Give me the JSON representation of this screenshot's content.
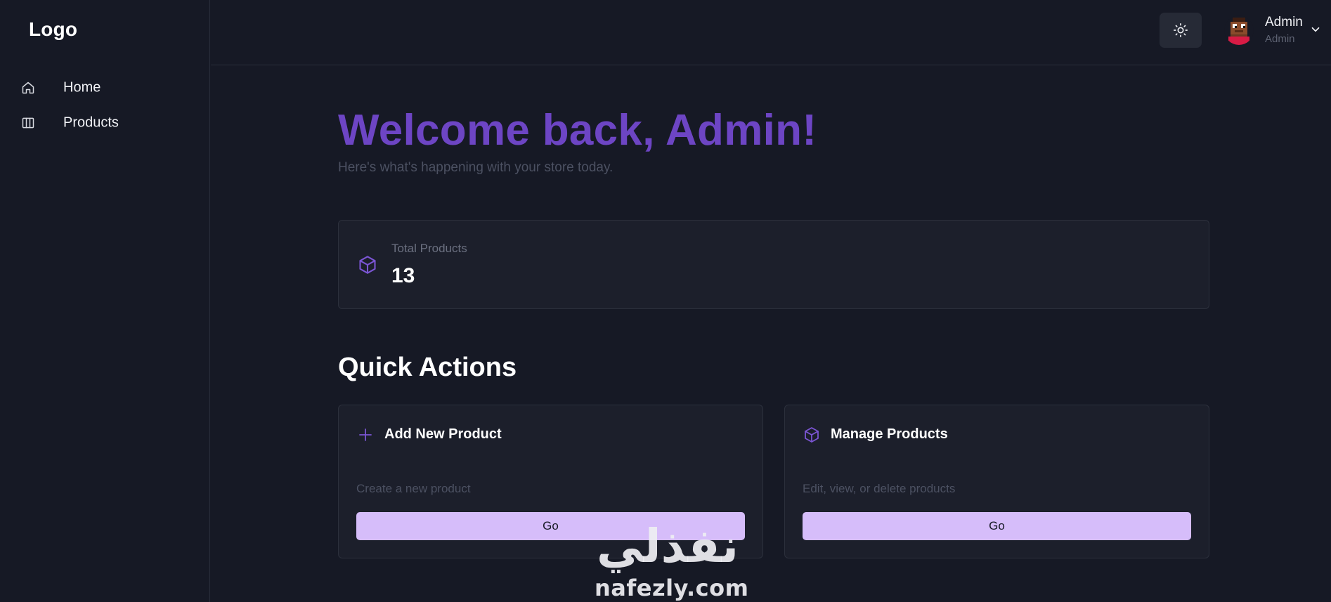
{
  "sidebar": {
    "logo": "Logo",
    "items": [
      {
        "label": "Home",
        "icon": "home-icon"
      },
      {
        "label": "Products",
        "icon": "columns-icon"
      }
    ]
  },
  "header": {
    "theme_toggle_icon": "sun-icon",
    "user": {
      "name": "Admin",
      "role": "Admin",
      "avatar_icon": "pixel-avatar",
      "menu_icon": "chevron-down-icon"
    }
  },
  "main": {
    "welcome": "Welcome back, Admin!",
    "subtitle": "Here's what's happening with your store today.",
    "stats": [
      {
        "label": "Total Products",
        "value": "13",
        "icon": "box-icon"
      }
    ],
    "quick_actions_title": "Quick Actions",
    "actions": [
      {
        "title": "Add New Product",
        "description": "Create a new product",
        "button": "Go",
        "icon": "plus-icon"
      },
      {
        "title": "Manage Products",
        "description": "Edit, view, or delete products",
        "button": "Go",
        "icon": "box-icon"
      }
    ]
  },
  "watermark": {
    "arabic": "نفذلي",
    "latin": "nafezly.com"
  },
  "colors": {
    "background": "#161925",
    "card": "#1c1f2b",
    "accent": "#6d45c4",
    "button": "#d6bdfa",
    "border": "#2c303c"
  }
}
